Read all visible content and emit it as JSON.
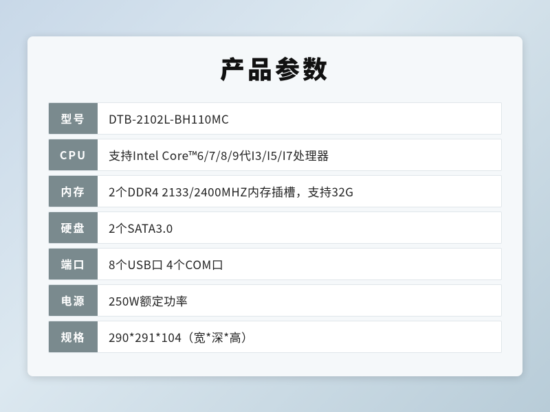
{
  "page": {
    "title": "产品参数",
    "specs": [
      {
        "label": "型号",
        "value": "DTB-2102L-BH110MC"
      },
      {
        "label": "CPU",
        "value": "支持Intel Core™6/7/8/9代I3/I5/I7处理器"
      },
      {
        "label": "内存",
        "value": "2个DDR4 2133/2400MHZ内存插槽，支持32G"
      },
      {
        "label": "硬盘",
        "value": "2个SATA3.0"
      },
      {
        "label": "端口",
        "value": "8个USB口 4个COM口"
      },
      {
        "label": "电源",
        "value": "250W额定功率"
      },
      {
        "label": "规格",
        "value": "290*291*104（宽*深*高）"
      }
    ]
  }
}
